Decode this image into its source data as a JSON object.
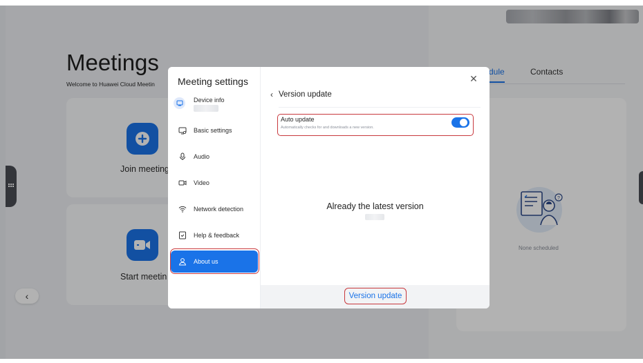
{
  "background": {
    "title": "Meetings",
    "subtitle": "Welcome to Huawei Cloud Meetin",
    "join_label": "Join meeting",
    "start_label": "Start meetin",
    "tabs": {
      "schedule": "dule",
      "contacts": "Contacts"
    },
    "empty_text": "None scheduled"
  },
  "dialog": {
    "nav_title": "Meeting settings",
    "device_info": "Device info",
    "nav_items": [
      {
        "label": "Basic settings",
        "icon": "basic-settings-icon"
      },
      {
        "label": "Audio",
        "icon": "microphone-icon"
      },
      {
        "label": "Video",
        "icon": "video-camera-icon"
      },
      {
        "label": "Network detection",
        "icon": "wifi-icon"
      },
      {
        "label": "Help & feedback",
        "icon": "help-feedback-icon"
      },
      {
        "label": "About us",
        "icon": "user-icon",
        "active": true
      }
    ],
    "content_title": "Version update",
    "auto_update": {
      "label": "Auto update",
      "description": "Automatically checks for and downloads a new version.",
      "enabled": true
    },
    "status": "Already the latest version",
    "footer_button": "Version update"
  },
  "colors": {
    "accent": "#1a73e8",
    "highlight": "#c8383d"
  }
}
